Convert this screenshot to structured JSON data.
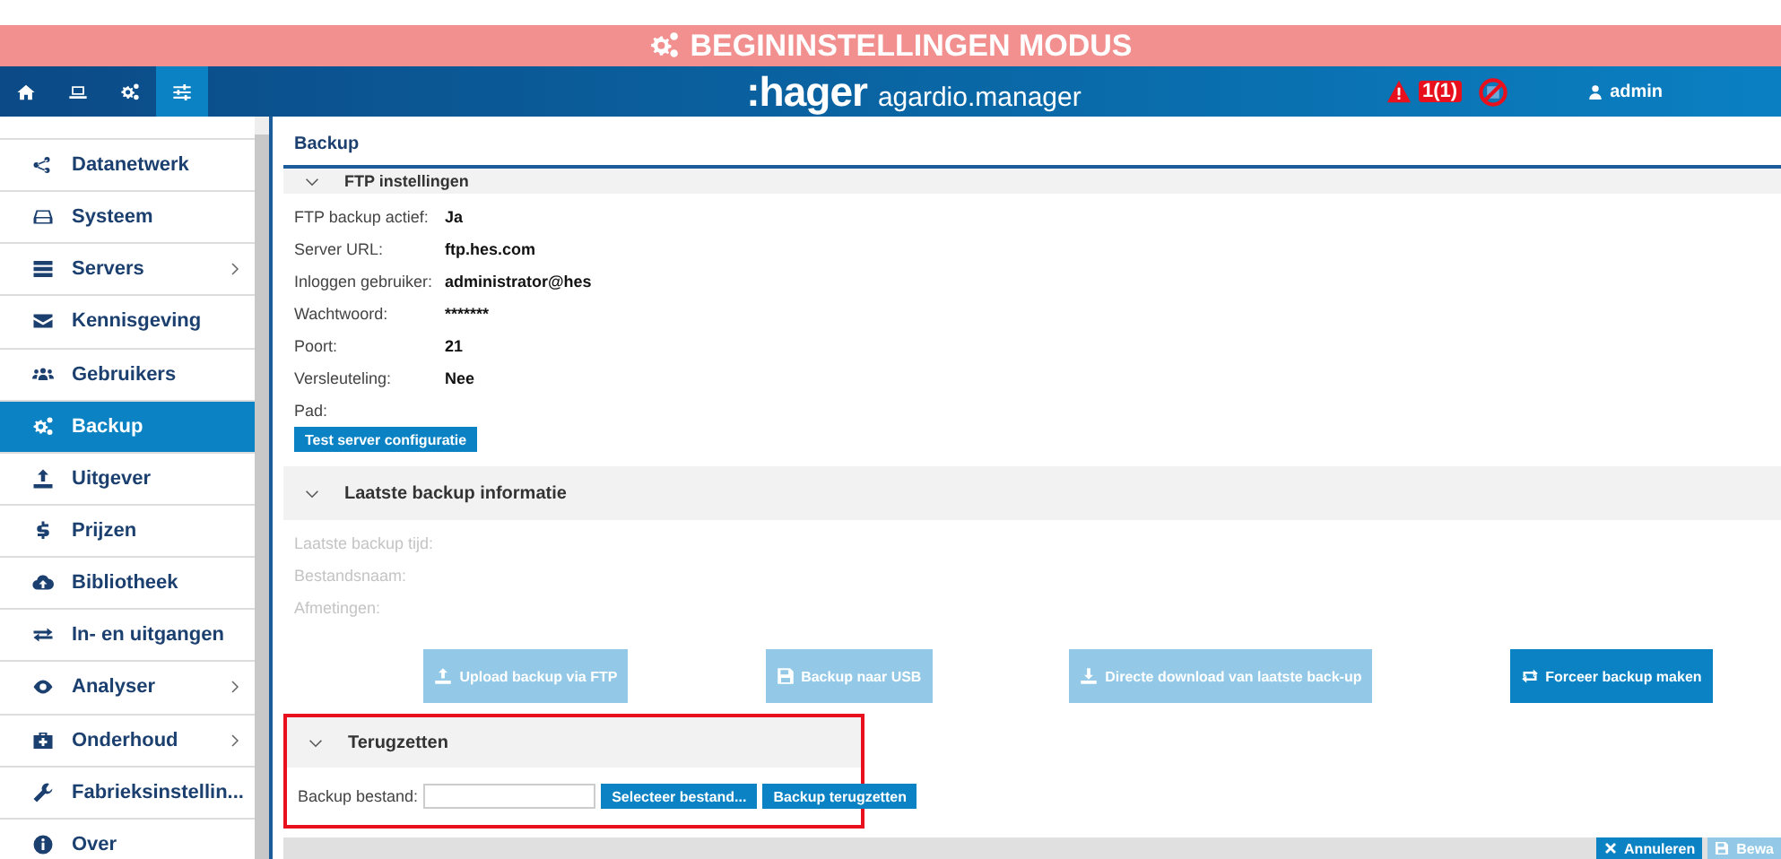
{
  "banner": {
    "title": "BEGININSTELLINGEN MODUS"
  },
  "nav": {
    "tabs": [
      {
        "selected": false
      },
      {
        "selected": false
      },
      {
        "selected": false
      },
      {
        "selected": true
      }
    ],
    "brand": ":hager",
    "product": "agardio.manager",
    "alert_count": "1(1)",
    "user": "admin"
  },
  "sidebar": {
    "items": [
      {
        "label": "Datanetwerk",
        "has_submenu": false,
        "selected": false
      },
      {
        "label": "Systeem",
        "has_submenu": false,
        "selected": false
      },
      {
        "label": "Servers",
        "has_submenu": true,
        "selected": false
      },
      {
        "label": "Kennisgeving",
        "has_submenu": false,
        "selected": false
      },
      {
        "label": "Gebruikers",
        "has_submenu": false,
        "selected": false
      },
      {
        "label": "Backup",
        "has_submenu": false,
        "selected": true
      },
      {
        "label": "Uitgever",
        "has_submenu": false,
        "selected": false
      },
      {
        "label": "Prijzen",
        "has_submenu": false,
        "selected": false
      },
      {
        "label": "Bibliotheek",
        "has_submenu": false,
        "selected": false
      },
      {
        "label": "In- en uitgangen",
        "has_submenu": false,
        "selected": false
      },
      {
        "label": "Analyser",
        "has_submenu": true,
        "selected": false
      },
      {
        "label": "Onderhoud",
        "has_submenu": true,
        "selected": false
      },
      {
        "label": "Fabrieksinstellin...",
        "has_submenu": false,
        "selected": false
      },
      {
        "label": "Over",
        "has_submenu": false,
        "selected": false
      }
    ]
  },
  "page_title": "Backup",
  "ftp": {
    "title": "FTP instellingen",
    "fields": [
      {
        "label": "FTP backup actief:",
        "value": "Ja",
        "disabled": false
      },
      {
        "label": "Server URL:",
        "value": "ftp.hes.com",
        "disabled": false
      },
      {
        "label": "Inloggen gebruiker:",
        "value": "administrator@hes",
        "disabled": false
      },
      {
        "label": "Wachtwoord:",
        "value": "*******",
        "disabled": false
      },
      {
        "label": "Poort:",
        "value": "21",
        "disabled": false
      },
      {
        "label": "Versleuteling:",
        "value": "Nee",
        "disabled": false
      },
      {
        "label": "Pad:",
        "disabled": false
      }
    ],
    "button": "Test server configuratie"
  },
  "last_backup": {
    "title": "Laatste backup informatie",
    "fields": [
      {
        "label": "Laatste backup tijd:",
        "disabled": true
      },
      {
        "label": "Bestandsnaam:",
        "disabled": true
      },
      {
        "label": "Afmetingen:",
        "disabled": true
      }
    ],
    "buttons": [
      {
        "label": "Upload backup via FTP",
        "disabled": true
      },
      {
        "label": "Backup naar USB",
        "disabled": true
      },
      {
        "label": "Directe download van laatste back-up",
        "disabled": true
      },
      {
        "label": "Forceer backup maken",
        "disabled": false
      }
    ]
  },
  "restore": {
    "title": "Terugzetten",
    "highlighted": true,
    "field_label": "Backup bestand:",
    "buttons": [
      "Selecteer bestand...",
      "Backup terugzetten"
    ]
  },
  "footer": {
    "buttons": [
      {
        "label": "Annuleren",
        "disabled": false
      },
      {
        "label": "Bewa",
        "disabled": true
      }
    ]
  }
}
